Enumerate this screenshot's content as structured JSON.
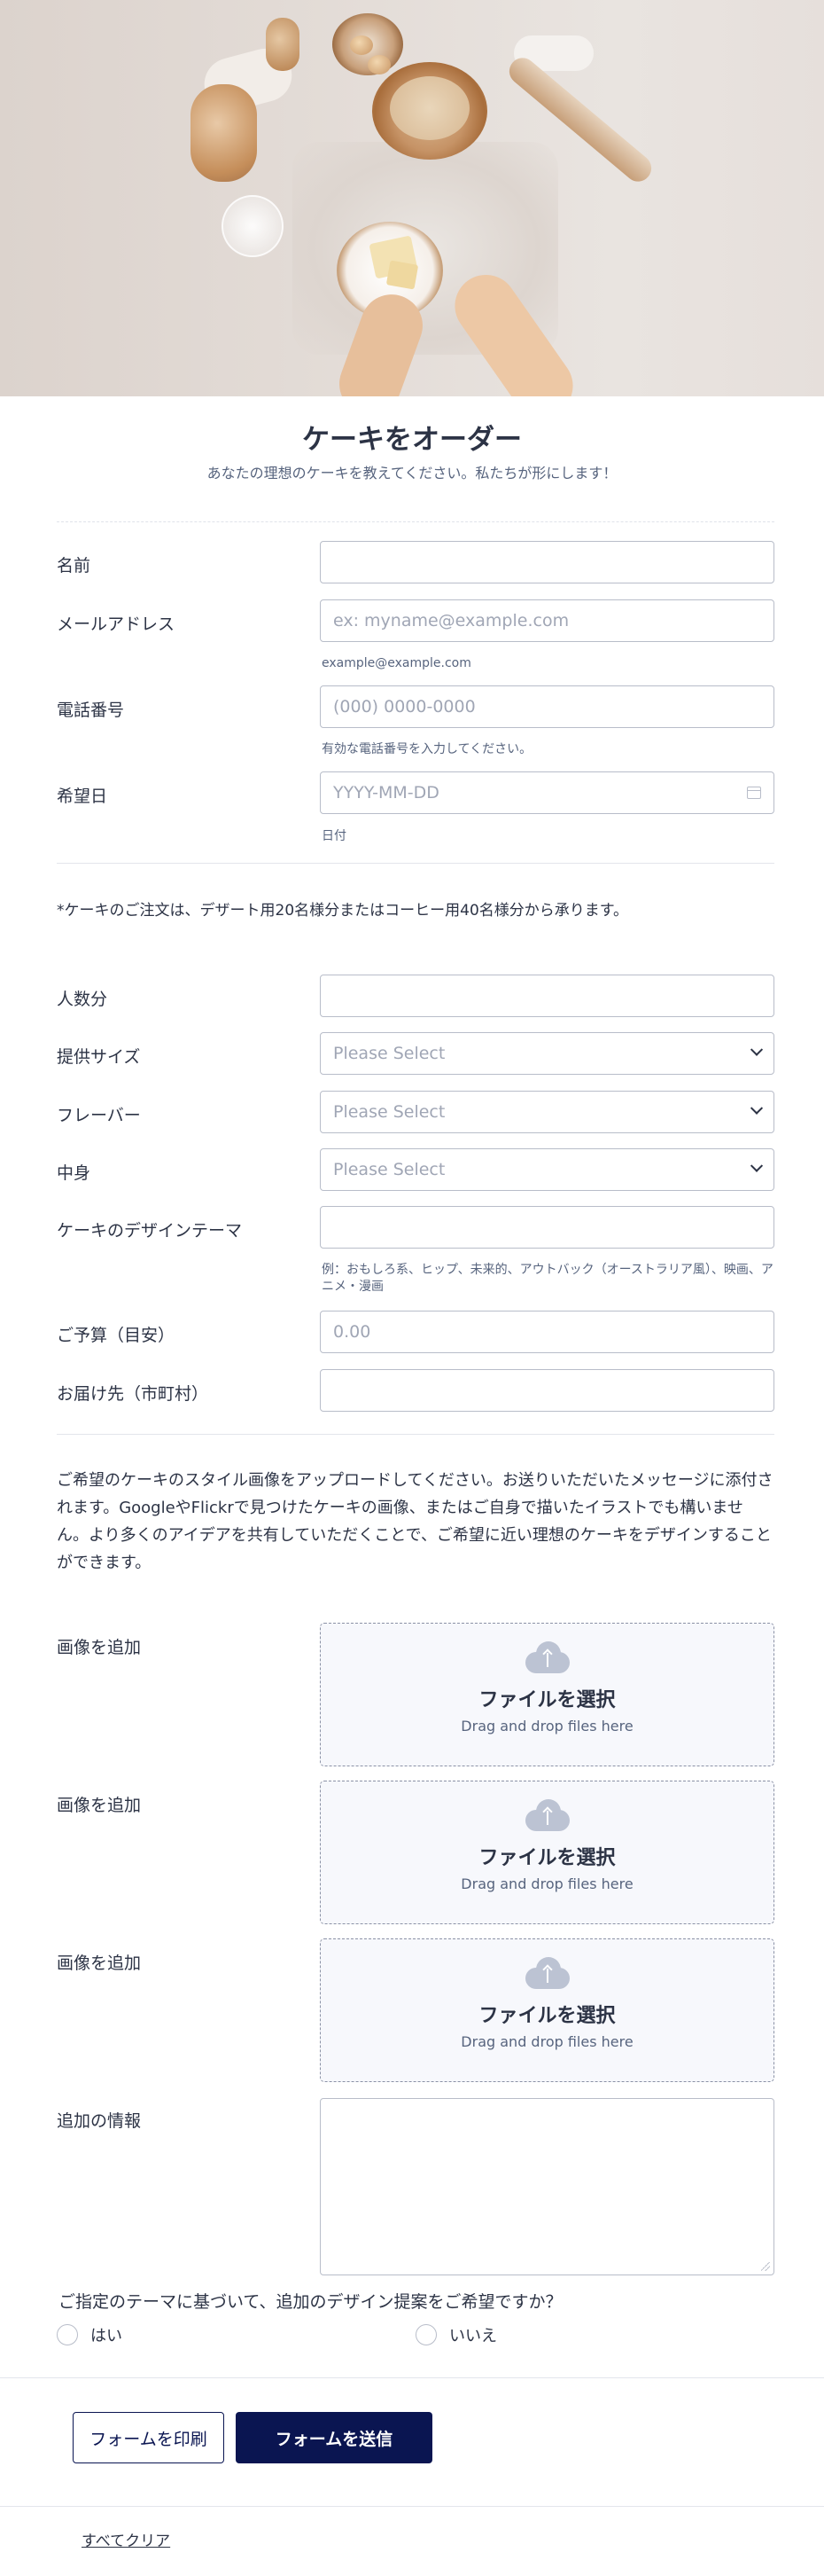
{
  "header": {
    "title": "ケーキをオーダー",
    "subtitle": "あなたの理想のケーキを教えてください。私たちが形にします！"
  },
  "fields": {
    "name": {
      "label": "名前",
      "value": ""
    },
    "email": {
      "label": "メールアドレス",
      "placeholder": "ex: myname@example.com",
      "sublabel": "example@example.com"
    },
    "phone": {
      "label": "電話番号",
      "placeholder": "(000) 0000-0000",
      "sublabel": "有効な電話番号を入力してください。"
    },
    "date": {
      "label": "希望日",
      "placeholder": "YYYY-MM-DD",
      "sublabel": "日付",
      "icon": "calendar-icon"
    }
  },
  "order_note": "*ケーキのご注文は、デザート用20名様分またはコーヒー用40名様分から承ります。",
  "cake_fields": {
    "servings": {
      "label": "人数分",
      "value": ""
    },
    "size": {
      "label": "提供サイズ",
      "selected": "Please Select"
    },
    "flavor": {
      "label": "フレーバー",
      "selected": "Please Select"
    },
    "filling": {
      "label": "中身",
      "selected": "Please Select"
    },
    "theme": {
      "label": "ケーキのデザインテーマ",
      "value": "",
      "sublabel": "例：おもしろ系、ヒップ、未来的、アウトバック（オーストラリア風）、映画、アニメ・漫画"
    },
    "budget": {
      "label": "ご予算（目安）",
      "placeholder": "0.00"
    },
    "delivery": {
      "label": "お届け先（市町村）",
      "value": ""
    }
  },
  "upload_note": "ご希望のケーキのスタイル画像をアップロードしてください。お送りいただいたメッセージに添付されます。GoogleやFlickrで見つけたケーキの画像、またはご自身で描いたイラストでも構いません。より多くのアイデアを共有していただくことで、ご希望に近い理想のケーキをデザインすることができます。",
  "uploads": [
    {
      "label": "画像を追加",
      "button": "ファイルを選択",
      "hint": "Drag and drop files here"
    },
    {
      "label": "画像を追加",
      "button": "ファイルを選択",
      "hint": "Drag and drop files here"
    },
    {
      "label": "画像を追加",
      "button": "ファイルを選択",
      "hint": "Drag and drop files here"
    }
  ],
  "additional_info": {
    "label": "追加の情報",
    "value": ""
  },
  "design_question": {
    "question": "ご指定のテーマに基づいて、追加のデザイン提案をご希望ですか？",
    "options": [
      "はい",
      "いいえ"
    ]
  },
  "actions": {
    "print": "フォームを印刷",
    "submit": "フォームを送信",
    "clear": "すべてクリア"
  },
  "colors": {
    "primary_button": "#0a1551",
    "text": "#2c3345",
    "border": "#b8bdc9"
  }
}
